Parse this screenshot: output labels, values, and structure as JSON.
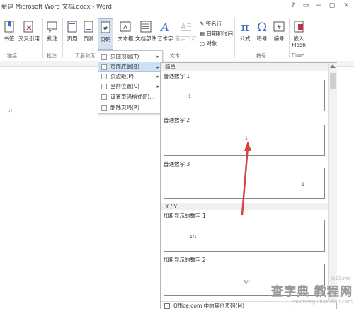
{
  "window": {
    "title": "新建 Microsoft Word 文档.docx - Word",
    "controls": [
      "?",
      "▭",
      "−",
      "▢",
      "✕"
    ]
  },
  "ribbon": {
    "buttons": {
      "bookmark": "书签",
      "crossref": "交叉引用",
      "comment": "批注",
      "header": "页眉",
      "footer": "页脚",
      "pagenum": "页码",
      "textbox": "文本框",
      "docparts": "文档部件",
      "wordart": "艺术字",
      "dropcap": "首字下沉",
      "signature": "签名行",
      "datetime": "日期和时间",
      "object": "对象",
      "equation": "公式",
      "symbol": "符号",
      "number": "编号",
      "flash": "嵌入\nFlash"
    },
    "groups": {
      "links": "链接",
      "comments": "批注",
      "headerfooter": "页眉和页",
      "text": "文本",
      "symbols": "符号",
      "flash": "Flash"
    }
  },
  "pagenum_menu": {
    "items": [
      {
        "label": "页面顶端(T)",
        "has_sub": true
      },
      {
        "label": "页面底端(B)",
        "has_sub": true,
        "selected": true
      },
      {
        "label": "页边距(P)",
        "has_sub": true
      },
      {
        "label": "当前位置(C)",
        "has_sub": true
      },
      {
        "label": "设置页码格式(F)...",
        "has_sub": false
      },
      {
        "label": "删除页码(R)",
        "has_sub": false
      }
    ]
  },
  "gallery": {
    "section_simple": "简单",
    "section_xy": "X / Y",
    "items": [
      {
        "title": "普通数字 1",
        "num": "1"
      },
      {
        "title": "普通数字 2",
        "num": "1"
      },
      {
        "title": "普通数字 3",
        "num": "1"
      },
      {
        "title": "加粗显示的数字 1",
        "num": "1/1"
      },
      {
        "title": "加粗显示的数字 2",
        "num": "1/1"
      }
    ],
    "footer": "Office.com 中的其他页码(M)"
  },
  "document": {
    "paragraph_mark": "↵"
  },
  "annotation": {
    "arrow_color": "#d94040"
  },
  "watermark": {
    "line1": "查字典 教程网",
    "line2": "jiaocheng.chazidian.com",
    "corner": "jb51.net"
  }
}
